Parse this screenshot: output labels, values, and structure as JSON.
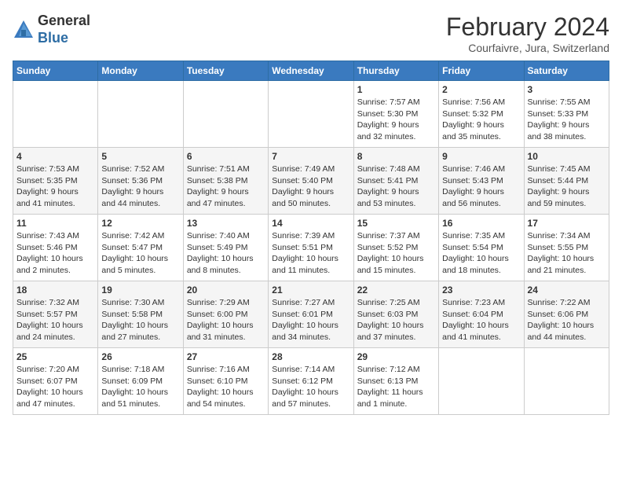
{
  "header": {
    "logo_line1": "General",
    "logo_line2": "Blue",
    "month": "February 2024",
    "location": "Courfaivre, Jura, Switzerland"
  },
  "weekdays": [
    "Sunday",
    "Monday",
    "Tuesday",
    "Wednesday",
    "Thursday",
    "Friday",
    "Saturday"
  ],
  "weeks": [
    [
      {
        "day": "",
        "info": ""
      },
      {
        "day": "",
        "info": ""
      },
      {
        "day": "",
        "info": ""
      },
      {
        "day": "",
        "info": ""
      },
      {
        "day": "1",
        "info": "Sunrise: 7:57 AM\nSunset: 5:30 PM\nDaylight: 9 hours\nand 32 minutes."
      },
      {
        "day": "2",
        "info": "Sunrise: 7:56 AM\nSunset: 5:32 PM\nDaylight: 9 hours\nand 35 minutes."
      },
      {
        "day": "3",
        "info": "Sunrise: 7:55 AM\nSunset: 5:33 PM\nDaylight: 9 hours\nand 38 minutes."
      }
    ],
    [
      {
        "day": "4",
        "info": "Sunrise: 7:53 AM\nSunset: 5:35 PM\nDaylight: 9 hours\nand 41 minutes."
      },
      {
        "day": "5",
        "info": "Sunrise: 7:52 AM\nSunset: 5:36 PM\nDaylight: 9 hours\nand 44 minutes."
      },
      {
        "day": "6",
        "info": "Sunrise: 7:51 AM\nSunset: 5:38 PM\nDaylight: 9 hours\nand 47 minutes."
      },
      {
        "day": "7",
        "info": "Sunrise: 7:49 AM\nSunset: 5:40 PM\nDaylight: 9 hours\nand 50 minutes."
      },
      {
        "day": "8",
        "info": "Sunrise: 7:48 AM\nSunset: 5:41 PM\nDaylight: 9 hours\nand 53 minutes."
      },
      {
        "day": "9",
        "info": "Sunrise: 7:46 AM\nSunset: 5:43 PM\nDaylight: 9 hours\nand 56 minutes."
      },
      {
        "day": "10",
        "info": "Sunrise: 7:45 AM\nSunset: 5:44 PM\nDaylight: 9 hours\nand 59 minutes."
      }
    ],
    [
      {
        "day": "11",
        "info": "Sunrise: 7:43 AM\nSunset: 5:46 PM\nDaylight: 10 hours\nand 2 minutes."
      },
      {
        "day": "12",
        "info": "Sunrise: 7:42 AM\nSunset: 5:47 PM\nDaylight: 10 hours\nand 5 minutes."
      },
      {
        "day": "13",
        "info": "Sunrise: 7:40 AM\nSunset: 5:49 PM\nDaylight: 10 hours\nand 8 minutes."
      },
      {
        "day": "14",
        "info": "Sunrise: 7:39 AM\nSunset: 5:51 PM\nDaylight: 10 hours\nand 11 minutes."
      },
      {
        "day": "15",
        "info": "Sunrise: 7:37 AM\nSunset: 5:52 PM\nDaylight: 10 hours\nand 15 minutes."
      },
      {
        "day": "16",
        "info": "Sunrise: 7:35 AM\nSunset: 5:54 PM\nDaylight: 10 hours\nand 18 minutes."
      },
      {
        "day": "17",
        "info": "Sunrise: 7:34 AM\nSunset: 5:55 PM\nDaylight: 10 hours\nand 21 minutes."
      }
    ],
    [
      {
        "day": "18",
        "info": "Sunrise: 7:32 AM\nSunset: 5:57 PM\nDaylight: 10 hours\nand 24 minutes."
      },
      {
        "day": "19",
        "info": "Sunrise: 7:30 AM\nSunset: 5:58 PM\nDaylight: 10 hours\nand 27 minutes."
      },
      {
        "day": "20",
        "info": "Sunrise: 7:29 AM\nSunset: 6:00 PM\nDaylight: 10 hours\nand 31 minutes."
      },
      {
        "day": "21",
        "info": "Sunrise: 7:27 AM\nSunset: 6:01 PM\nDaylight: 10 hours\nand 34 minutes."
      },
      {
        "day": "22",
        "info": "Sunrise: 7:25 AM\nSunset: 6:03 PM\nDaylight: 10 hours\nand 37 minutes."
      },
      {
        "day": "23",
        "info": "Sunrise: 7:23 AM\nSunset: 6:04 PM\nDaylight: 10 hours\nand 41 minutes."
      },
      {
        "day": "24",
        "info": "Sunrise: 7:22 AM\nSunset: 6:06 PM\nDaylight: 10 hours\nand 44 minutes."
      }
    ],
    [
      {
        "day": "25",
        "info": "Sunrise: 7:20 AM\nSunset: 6:07 PM\nDaylight: 10 hours\nand 47 minutes."
      },
      {
        "day": "26",
        "info": "Sunrise: 7:18 AM\nSunset: 6:09 PM\nDaylight: 10 hours\nand 51 minutes."
      },
      {
        "day": "27",
        "info": "Sunrise: 7:16 AM\nSunset: 6:10 PM\nDaylight: 10 hours\nand 54 minutes."
      },
      {
        "day": "28",
        "info": "Sunrise: 7:14 AM\nSunset: 6:12 PM\nDaylight: 10 hours\nand 57 minutes."
      },
      {
        "day": "29",
        "info": "Sunrise: 7:12 AM\nSunset: 6:13 PM\nDaylight: 11 hours\nand 1 minute."
      },
      {
        "day": "",
        "info": ""
      },
      {
        "day": "",
        "info": ""
      }
    ]
  ]
}
